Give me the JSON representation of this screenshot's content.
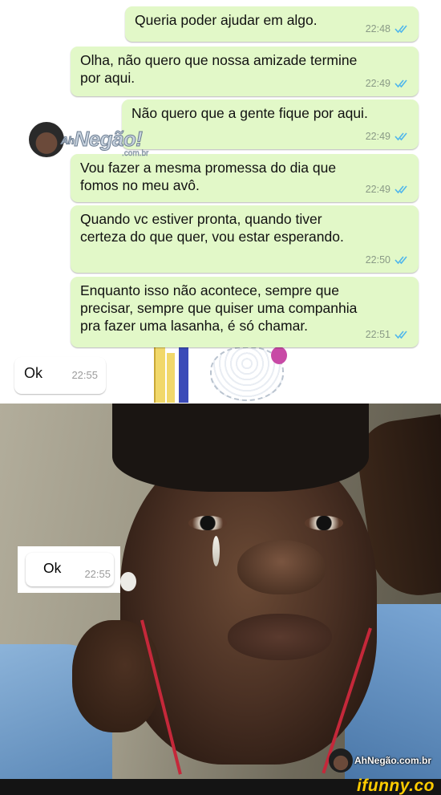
{
  "colors": {
    "outgoing_bubble": "#e2f8c8",
    "incoming_bubble": "#ffffff",
    "read_ticks": "#4fb6ec",
    "footer_bg": "#141414",
    "ifunny_yellow": "#ffcc00"
  },
  "messages": [
    {
      "direction": "outgoing",
      "text": "Queria poder ajudar em algo.",
      "time": "22:48",
      "status_icon": "double-check-read-icon"
    },
    {
      "direction": "outgoing",
      "text": "Olha, não quero que nossa amizade termine\npor aqui.",
      "time": "22:49",
      "status_icon": "double-check-read-icon"
    },
    {
      "direction": "outgoing",
      "text": "Não quero que a gente fique por aqui.",
      "time": "22:49",
      "status_icon": "double-check-read-icon"
    },
    {
      "direction": "outgoing",
      "text": "Vou fazer a mesma promessa do dia que\nfomos no meu avô.",
      "time": "22:49",
      "status_icon": "double-check-read-icon"
    },
    {
      "direction": "outgoing",
      "text": "Quando vc estiver pronta, quando tiver\ncerteza do que quer, vou estar esperando.",
      "time": "22:50",
      "status_icon": "double-check-read-icon"
    },
    {
      "direction": "outgoing",
      "text": "Enquanto isso não acontece, sempre que\nprecisar, sempre que quiser uma companhia\npra fazer uma lasanha, é só chamar.",
      "time": "22:51",
      "status_icon": "double-check-read-icon"
    },
    {
      "direction": "incoming",
      "text": "Ok",
      "time": "22:55"
    }
  ],
  "photo_overlay": {
    "text": "Ok",
    "time": "22:55"
  },
  "watermarks": {
    "top_brand": "Negão!",
    "top_prefix": "Ah",
    "top_domain": ".com.br",
    "bottom": "AhNegão.com.br",
    "footer": "ifunny.co"
  }
}
